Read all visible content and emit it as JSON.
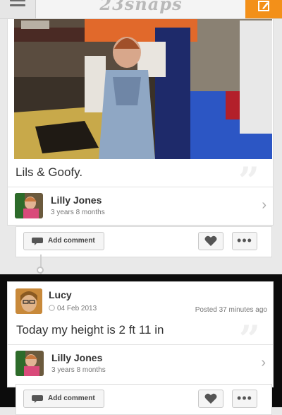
{
  "app": {
    "logo": "23snaps"
  },
  "posts": [
    {
      "caption": "Lils & Goofy.",
      "child": {
        "name": "Lilly Jones",
        "age": "3 years 8 months"
      },
      "actions": {
        "add_comment": "Add comment"
      }
    },
    {
      "author": "Lucy",
      "date": "04 Feb 2013",
      "posted": "Posted 37 minutes ago",
      "caption": "Today my height is 2 ft 11 in",
      "child": {
        "name": "Lilly Jones",
        "age": "3 years 8 months"
      },
      "actions": {
        "add_comment": "Add comment"
      }
    }
  ],
  "icons": [
    "menu-icon",
    "compose-icon",
    "quote-icon",
    "chevron-right-icon",
    "comment-icon",
    "heart-icon",
    "more-icon",
    "clock-icon"
  ],
  "colors": {
    "accent": "#f39019",
    "dark_frame": "#0c0c0c"
  }
}
